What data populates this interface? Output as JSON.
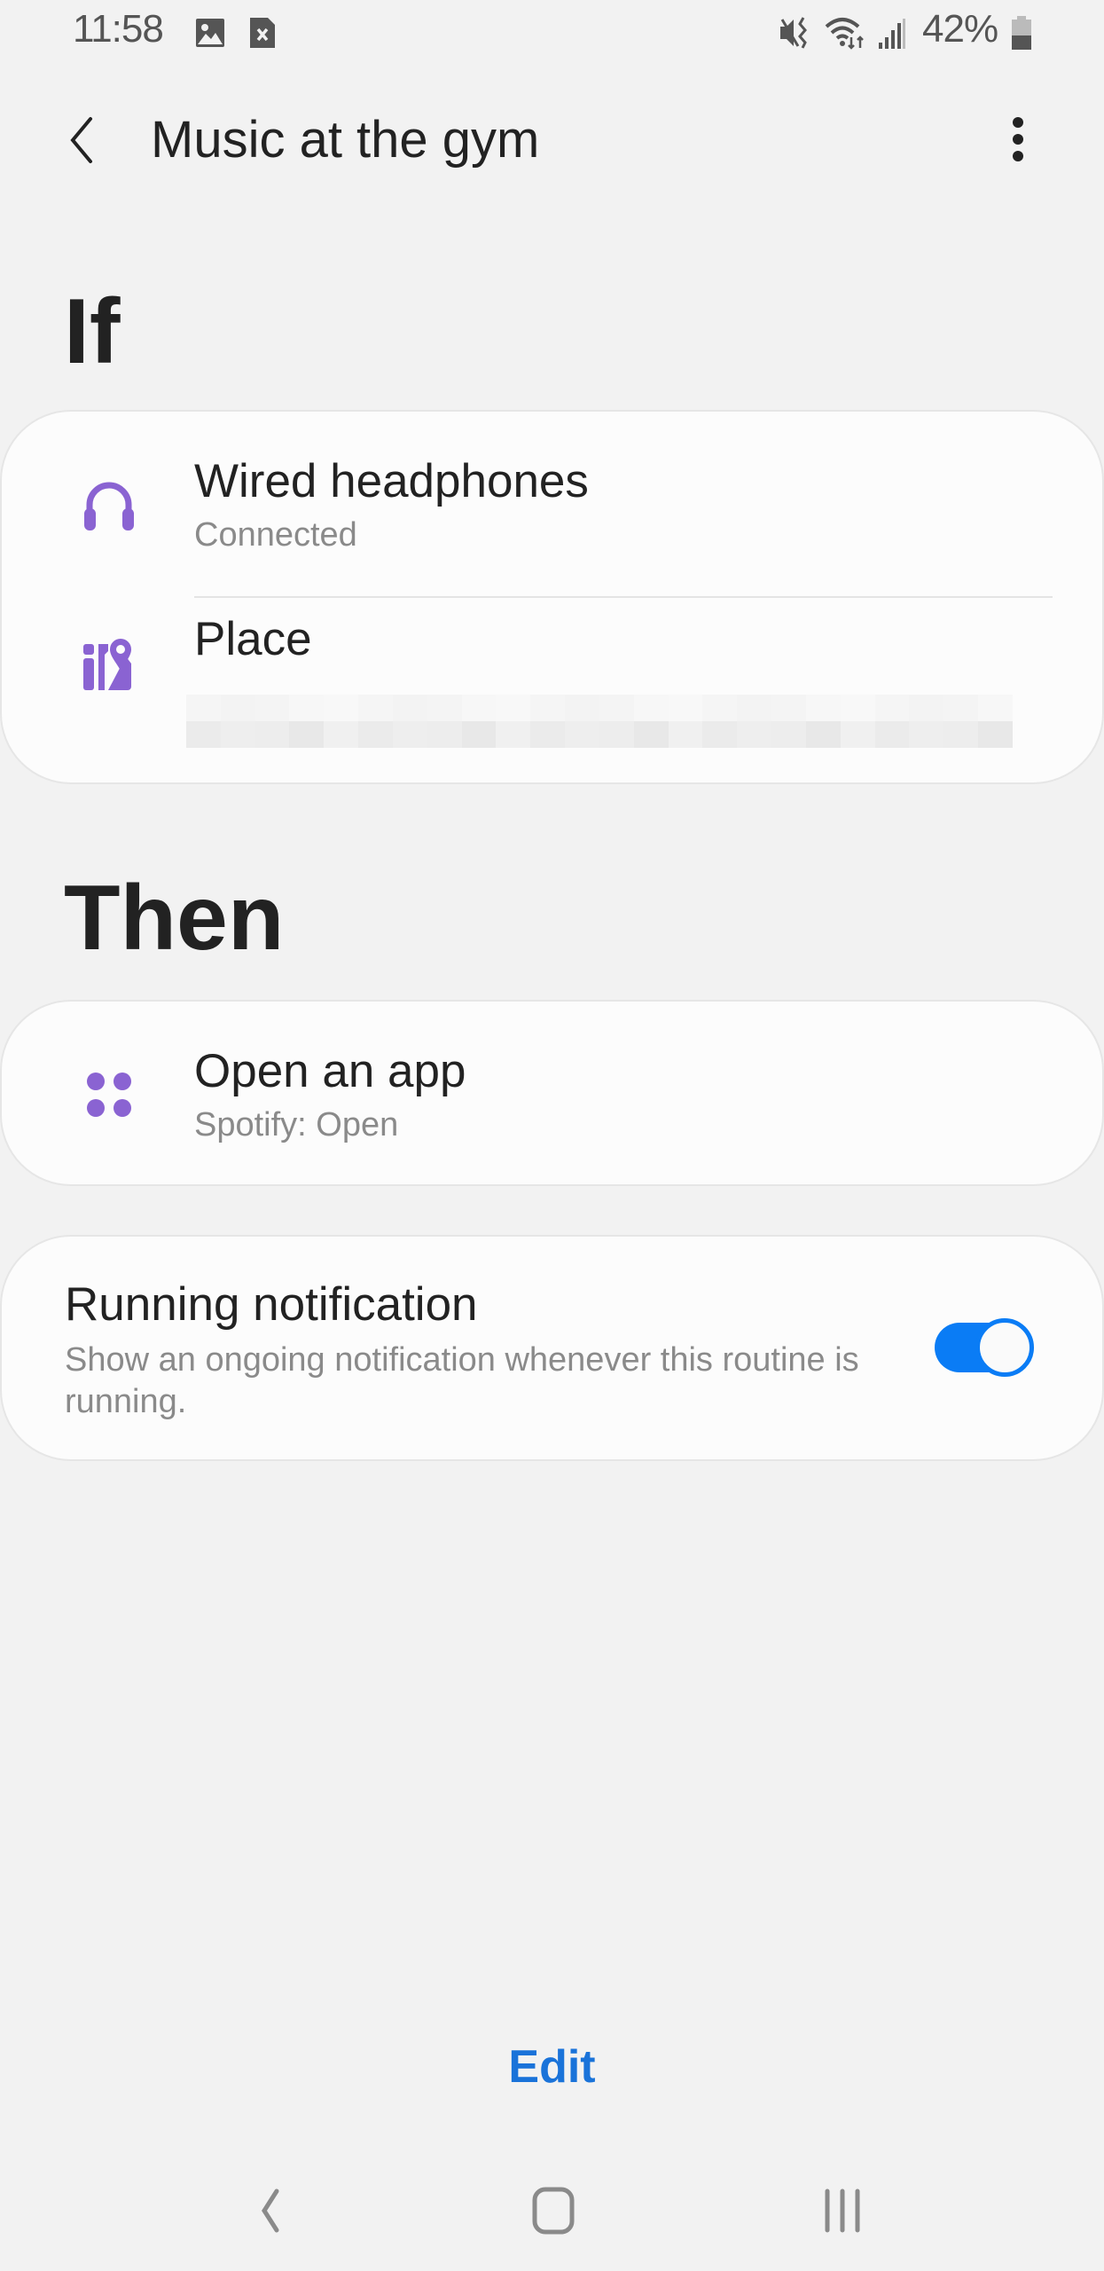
{
  "status_bar": {
    "time": "11:58",
    "left_icons": [
      "image-notification-icon",
      "sim-error-icon"
    ],
    "right_icons": [
      "vibrate-mute-icon",
      "wifi-icon",
      "signal-icon",
      "battery-icon"
    ],
    "battery_percent": "42%",
    "battery_level": 0.42
  },
  "header": {
    "title": "Music at the gym",
    "back_icon": "back-arrow-icon",
    "more_icon": "more-options-icon"
  },
  "if_section": {
    "heading": "If",
    "conditions": [
      {
        "icon": "headphones-icon",
        "title": "Wired headphones",
        "subtitle": "Connected"
      },
      {
        "icon": "place-map-icon",
        "title": "Place",
        "subtitle_redacted": true
      }
    ]
  },
  "then_section": {
    "heading": "Then",
    "actions": [
      {
        "icon": "apps-icon",
        "title": "Open an app",
        "subtitle": "Spotify: Open"
      }
    ]
  },
  "running_notification": {
    "title": "Running notification",
    "description": "Show an ongoing notification whenever this routine is running.",
    "enabled": true
  },
  "edit_label": "Edit",
  "nav_bar": [
    "back-nav-icon",
    "home-nav-icon",
    "recents-nav-icon"
  ],
  "colors": {
    "accent": "#0a7cf5",
    "icon_purple": "#8a63d2",
    "edit_blue": "#1a73d9",
    "background": "#f2f2f2"
  }
}
